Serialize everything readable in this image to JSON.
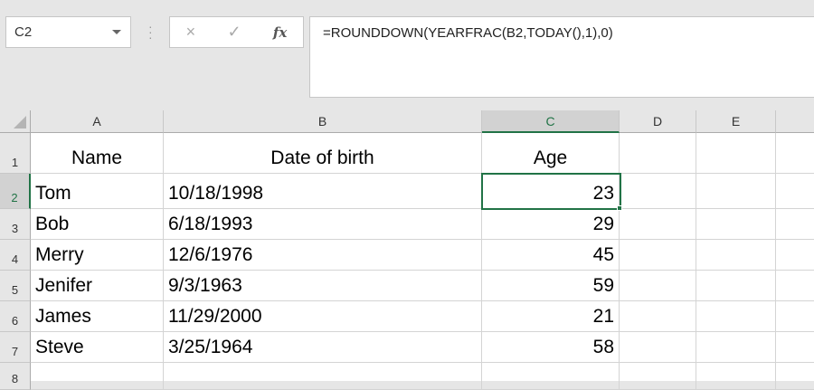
{
  "name_box": "C2",
  "formula_bar": {
    "cancel_icon": "×",
    "enter_icon": "✓",
    "fx_label": "fx",
    "formula": "=ROUNDDOWN(YEARFRAC(B2,TODAY(),1),0)"
  },
  "columns": [
    "A",
    "B",
    "C",
    "D",
    "E"
  ],
  "rows": [
    "1",
    "2",
    "3",
    "4",
    "5",
    "6",
    "7",
    "8"
  ],
  "headers": {
    "name": "Name",
    "dob": "Date of birth",
    "age": "Age"
  },
  "data": [
    {
      "name": "Tom",
      "dob": "10/18/1998",
      "age": "23"
    },
    {
      "name": "Bob",
      "dob": "6/18/1993",
      "age": "29"
    },
    {
      "name": "Merry",
      "dob": "12/6/1976",
      "age": "45"
    },
    {
      "name": "Jenifer",
      "dob": "9/3/1963",
      "age": "59"
    },
    {
      "name": "James",
      "dob": "11/29/2000",
      "age": "21"
    },
    {
      "name": "Steve",
      "dob": "3/25/1964",
      "age": "58"
    }
  ],
  "selected_color": "#217346"
}
